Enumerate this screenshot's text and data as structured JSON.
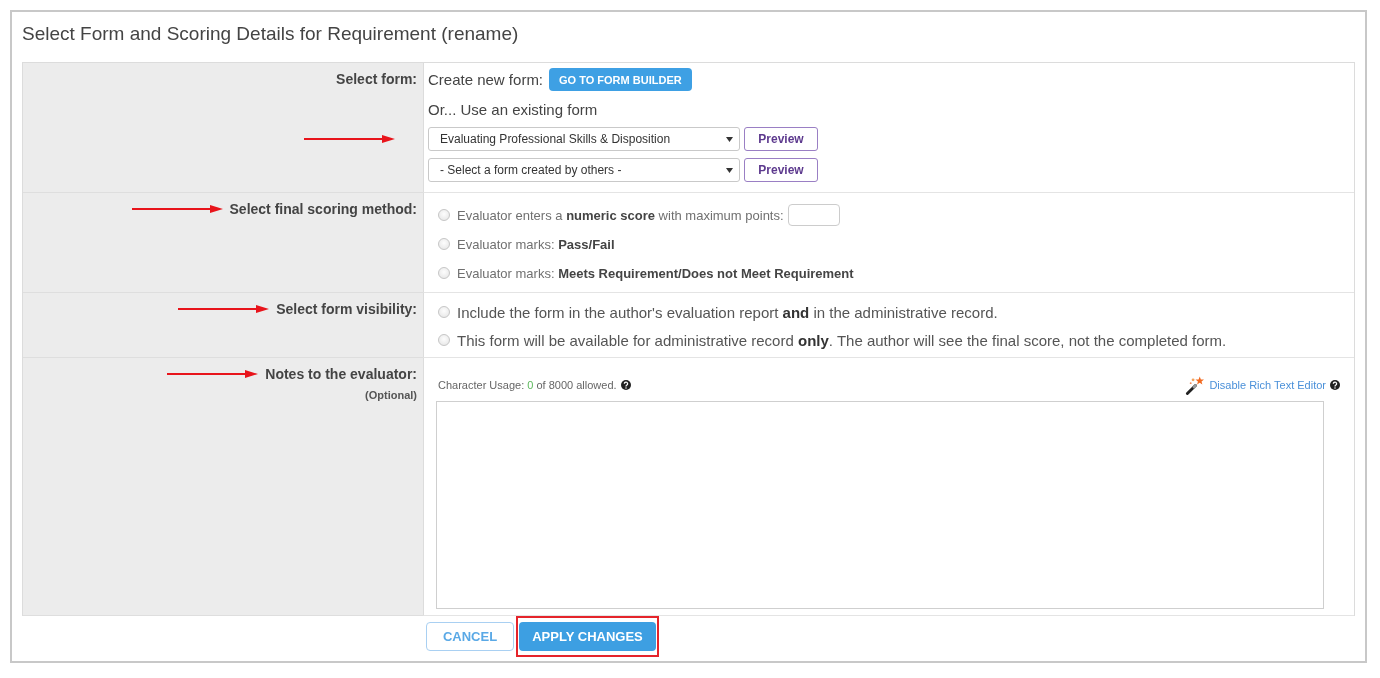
{
  "dialog": {
    "title": "Select Form and Scoring Details for Requirement (rename)"
  },
  "form_row": {
    "label": "Select form:",
    "create_label": "Create new form:",
    "builder_button": "GO TO FORM BUILDER",
    "existing_label": "Or... Use an existing form",
    "dropdowns": [
      {
        "value": "Evaluating Professional Skills & Disposition",
        "preview_button": "Preview",
        "annotated": true
      },
      {
        "value": "- Select a form created by others -",
        "preview_button": "Preview"
      }
    ]
  },
  "scoring_row": {
    "label": "Select final scoring method:",
    "annotated": true,
    "options": [
      {
        "kind": "input",
        "text": "Evaluator enters a **numeric score** with maximum points:",
        "selected": false
      },
      {
        "kind": "plain",
        "text": "Evaluator marks: **Pass/Fail**",
        "selected": false
      },
      {
        "kind": "plain",
        "text": "Evaluator marks: **Meets Requirement/Does not Meet Requirement**",
        "selected": false
      }
    ]
  },
  "visibility_row": {
    "label": "Select form visibility:",
    "annotated": true,
    "options": [
      {
        "text": "Include the form in the author's evaluation report **and** in the administrative record.",
        "selected": false
      },
      {
        "text": "This form will be available for administrative record **only**. The author will see the final score, not the completed form.",
        "selected": false
      }
    ]
  },
  "notes_row": {
    "label": "Notes to the evaluator:",
    "sublabel": "(Optional)",
    "annotated": true,
    "usage": {
      "label": "Character Usage:",
      "count": "0",
      "suffix": "of 8000 allowed."
    },
    "editor_link": "Disable Rich Text Editor"
  },
  "buttons": [
    {
      "kind": "secondary",
      "label": "CANCEL",
      "highlighted": false
    },
    {
      "kind": "primary",
      "label": "APPLY CHANGES",
      "highlighted": true
    }
  ]
}
